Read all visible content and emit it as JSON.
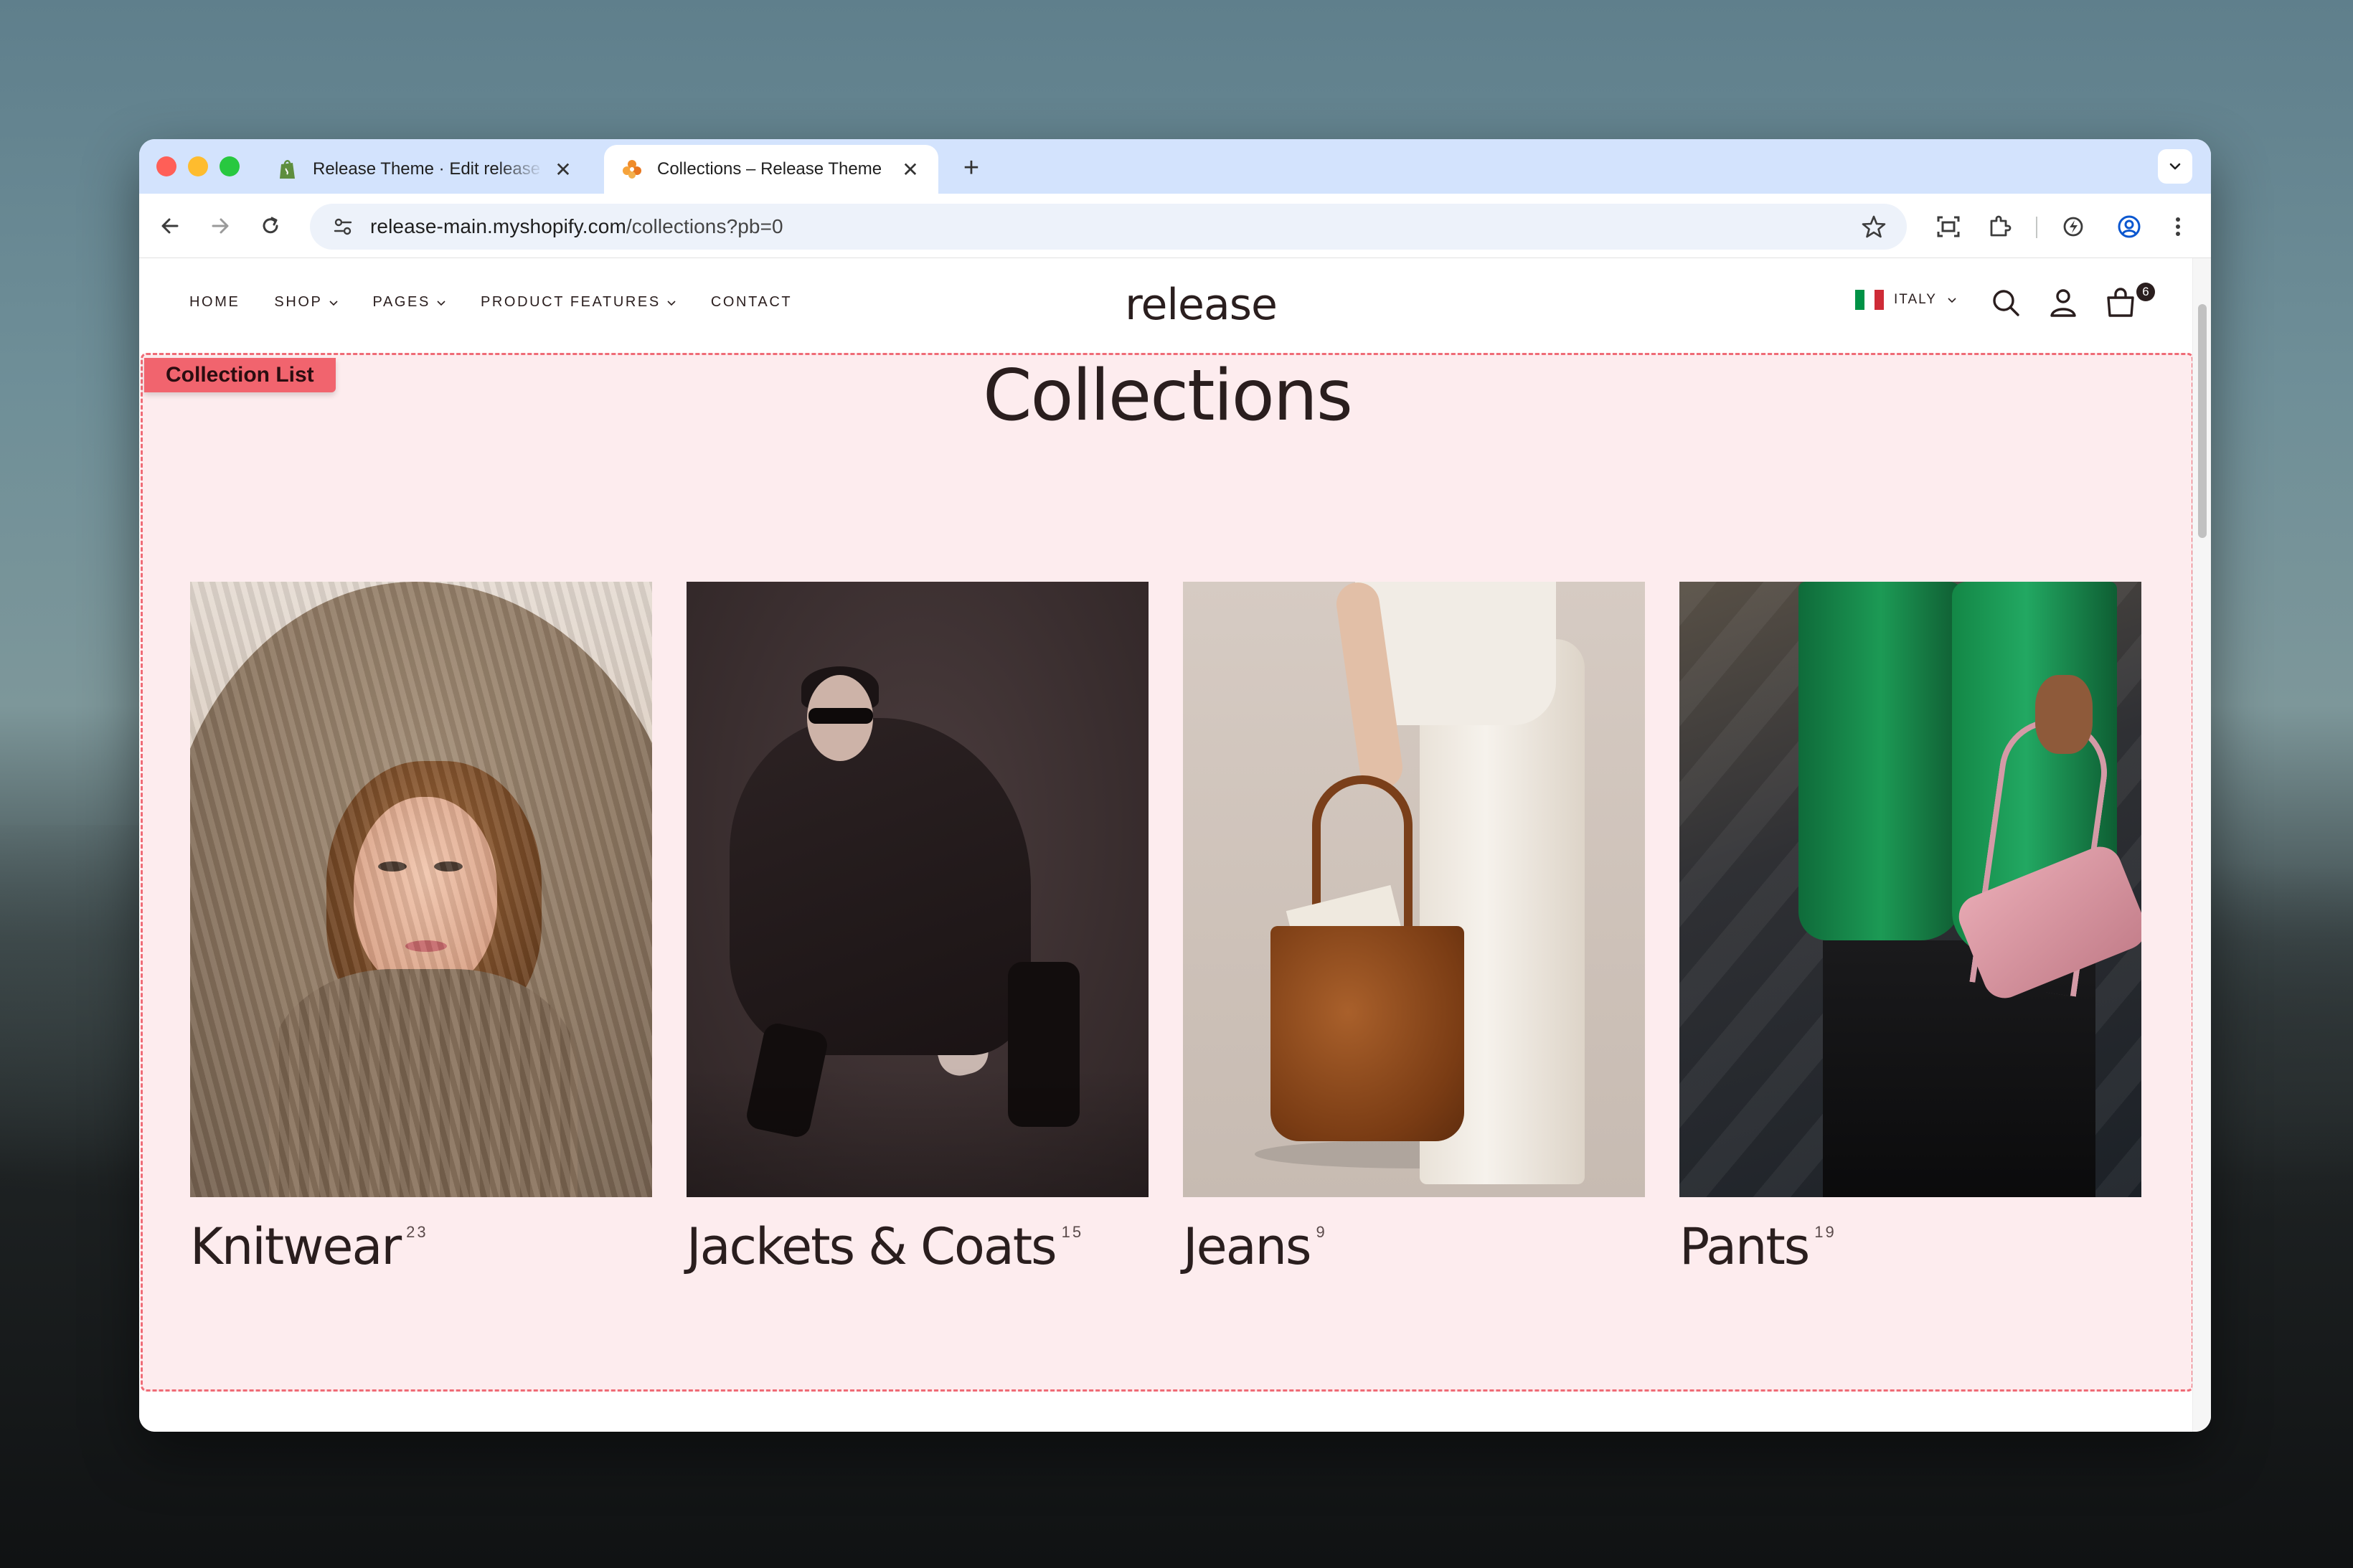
{
  "browser": {
    "tabs": [
      {
        "title": "Release Theme · Edit release",
        "active": false,
        "favicon": "shopify-icon"
      },
      {
        "title": "Collections – Release Theme",
        "active": true,
        "favicon": "release-favicon-icon"
      }
    ],
    "new_tab_symbol": "+",
    "close_symbol": "✕",
    "url_host": "release-main.myshopify.com",
    "url_path": "/collections?pb=0"
  },
  "site": {
    "nav": [
      {
        "label": "HOME",
        "dropdown": false
      },
      {
        "label": "SHOP",
        "dropdown": true
      },
      {
        "label": "PAGES",
        "dropdown": true
      },
      {
        "label": "PRODUCT FEATURES",
        "dropdown": true
      },
      {
        "label": "CONTACT",
        "dropdown": false
      }
    ],
    "logo": "release",
    "locale": "ITALY",
    "flag_colors": [
      "#009246",
      "#ffffff",
      "#ce2b37"
    ],
    "cart_count": "6"
  },
  "section": {
    "tag": "Collection List",
    "title": "Collections",
    "highlight_color": "#f1646e",
    "collections": [
      {
        "name": "Knitwear",
        "count": "23"
      },
      {
        "name": "Jackets & Coats",
        "count": "15"
      },
      {
        "name": "Jeans",
        "count": "9"
      },
      {
        "name": "Pants",
        "count": "19"
      }
    ]
  }
}
